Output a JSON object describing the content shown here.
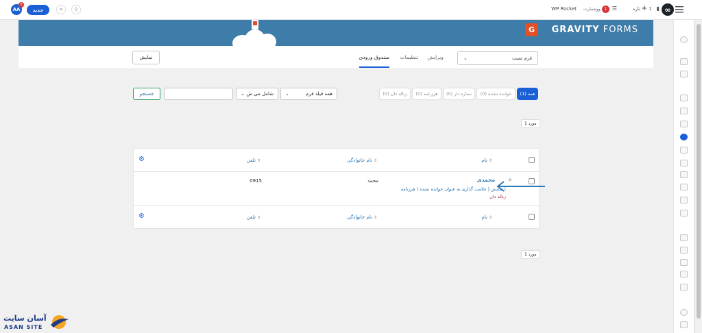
{
  "adminbar": {
    "avatar": "AA",
    "avatar_badge": "0",
    "new_label": "جدید",
    "site_name": "WP Rocket",
    "shop_name": "ووچمارت",
    "notif_count": "1",
    "new_item_label": "تازه",
    "comments_count": "1"
  },
  "gf_header": {
    "logo_letter": "G",
    "title_bold": "GRAVITY",
    "title_rest": "FORMS"
  },
  "toolbar": {
    "form_select_value": "فرم تست",
    "tabs": [
      {
        "label": "ویرایش"
      },
      {
        "label": "تنظیمات"
      },
      {
        "label": "صندوق ورودی"
      }
    ],
    "show_button": "نمایش"
  },
  "filters": {
    "pills": [
      {
        "label": "همه (1)"
      },
      {
        "label": "خوانده نشده (0)"
      },
      {
        "label": "ستاره دار (0)"
      },
      {
        "label": "هرزنامه (0)"
      },
      {
        "label": "زباله دان (0)"
      }
    ],
    "field_select": "همه فیلد فرم",
    "operator_select": "شامل می ش",
    "search_value": "",
    "search_button": "جستجو"
  },
  "pagination": {
    "top_count": "1 مورد",
    "bottom_count": "1 مورد"
  },
  "table": {
    "columns": [
      "نام",
      "نام خانوادگی",
      "تلفن"
    ],
    "rows": [
      {
        "name": "محمدی",
        "lastname": "محمد",
        "phone": "0915",
        "actions_line1": "نمایش | علامت گذاری به عنوان خوانده نشده | هرزنامه |",
        "actions_line2": "زباله دان"
      }
    ]
  },
  "watermark": {
    "fa": "آسان سایت",
    "en": "ASAN SITE"
  },
  "colors": {
    "accent": "#1b5fd6",
    "banner": "#3e7ca9",
    "gf_orange": "#e34f26",
    "arrow": "#2b7bb9"
  }
}
